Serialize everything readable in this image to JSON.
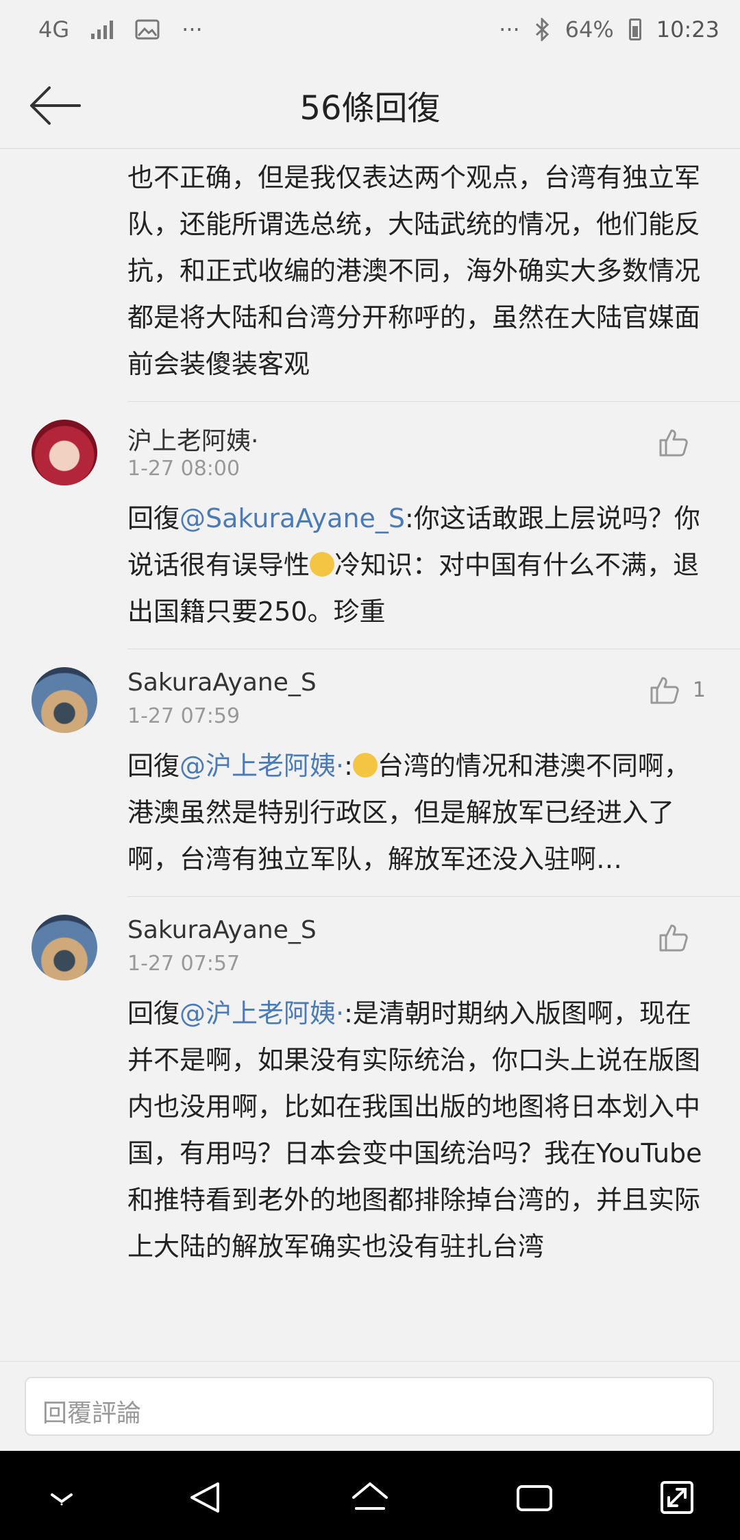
{
  "status": {
    "network": "4G",
    "more_left": "···",
    "more_right": "···",
    "battery": "64%",
    "time": "10:23"
  },
  "header": {
    "title": "56條回復"
  },
  "comments": [
    {
      "text_partial": "也不正确，但是我仅表达两个观点，台湾有独立军队，还能所谓选总统，大陆武统的情况，他们能反抗，和正式收编的港澳不同，海外确实大多数情况都是将大陆和台湾分开称呼的，虽然在大陆官媒面前会装傻装客观"
    },
    {
      "name": "沪上老阿姨·",
      "time": "1-27 08:00",
      "like_count": "",
      "reply_prefix": "回復",
      "mention": "@SakuraAyane_S",
      "text_a": ":你这话敢跟上层说吗？你说话很有误导性",
      "text_b": "冷知识：对中国有什么不满，退出国籍只要250。珍重"
    },
    {
      "name": "SakuraAyane_S",
      "time": "1-27 07:59",
      "like_count": "1",
      "reply_prefix": "回復",
      "mention": "@沪上老阿姨·",
      "text_a": ":",
      "text_b": "台湾的情况和港澳不同啊，港澳虽然是特别行政区，但是解放军已经进入了啊，台湾有独立军队，解放军还没入驻啊…"
    },
    {
      "name": "SakuraAyane_S",
      "time": "1-27 07:57",
      "like_count": "",
      "reply_prefix": "回復",
      "mention": "@沪上老阿姨·",
      "text_a": ":是清朝时期纳入版图啊，现在并不是啊，如果没有实际统治，你口头上说在版图内也没用啊，比如在我国出版的地图将日本划入中国，有用吗？日本会变中国统治吗？我在YouTube和推特看到老外的地图都排除掉台湾的，并且实际上大陆的解放军确实也没有驻扎台湾"
    }
  ],
  "reply_input": {
    "placeholder": "回覆評論"
  },
  "icons": {
    "back": "back-arrow-icon",
    "like": "thumbs-up-icon",
    "nav": [
      "down-chevron-icon",
      "back-triangle-icon",
      "home-icon",
      "recents-icon",
      "expand-icon"
    ]
  }
}
